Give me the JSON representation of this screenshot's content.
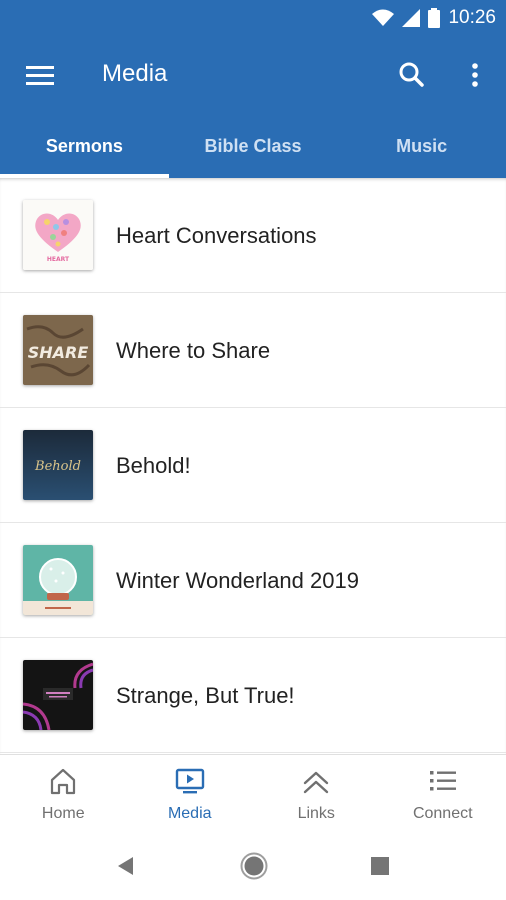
{
  "status_bar": {
    "time": "10:26"
  },
  "app_bar": {
    "title": "Media"
  },
  "tabs": [
    {
      "label": "Sermons",
      "active": true
    },
    {
      "label": "Bible Class",
      "active": false
    },
    {
      "label": "Music",
      "active": false
    }
  ],
  "list": [
    {
      "title": "Heart Conversations",
      "thumb_text": "HEART"
    },
    {
      "title": "Where to Share",
      "thumb_text": "SHARE"
    },
    {
      "title": "Behold!",
      "thumb_text": "Behold"
    },
    {
      "title": "Winter Wonderland 2019",
      "thumb_text": ""
    },
    {
      "title": "Strange, But True!",
      "thumb_text": ""
    }
  ],
  "bottom_nav": [
    {
      "label": "Home",
      "icon": "home-icon"
    },
    {
      "label": "Media",
      "icon": "media-icon",
      "active": true
    },
    {
      "label": "Links",
      "icon": "links-icon"
    },
    {
      "label": "Connect",
      "icon": "connect-icon"
    }
  ],
  "colors": {
    "primary": "#2a6db4",
    "text": "#222222",
    "muted": "#707070"
  }
}
